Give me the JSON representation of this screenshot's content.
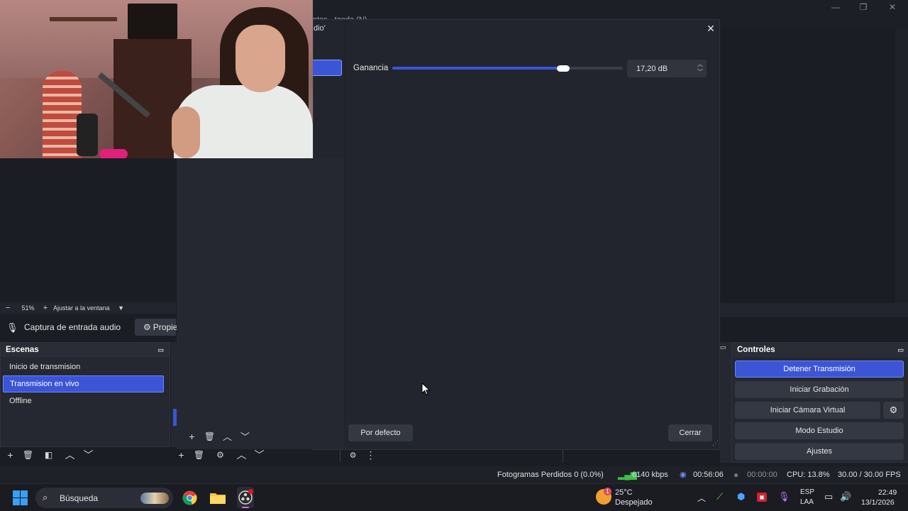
{
  "window": {
    "title_fragment": "dio'",
    "bg_title": "ntos - tanda (N)"
  },
  "dialog": {
    "gain_label": "Ganancia",
    "gain_value": "17,20 dB",
    "gain_level_pct": 74,
    "default_button": "Por defecto",
    "close_button": "Cerrar"
  },
  "preview": {
    "zoom": "51%",
    "fit_label": "Ajustar a la ventana"
  },
  "source_bar": {
    "source_name": "Captura de entrada audio",
    "props_label": "Propie"
  },
  "scenes": {
    "title": "Escenas",
    "items": [
      "Inicio de transmision",
      "Transmision en vivo",
      "Offline"
    ],
    "selected_index": 1
  },
  "controls": {
    "title": "Controles",
    "stop_stream": "Detener Transmisión",
    "start_record": "Iniciar Grabación",
    "start_vcam": "Iniciar Cámara Virtual",
    "studio_mode": "Modo Estudio",
    "settings": "Ajustes"
  },
  "status": {
    "dropped_frames": "Fotogramas Perdidos 0 (0.0%)",
    "bitrate": "6140 kbps",
    "stream_time": "00:56:06",
    "record_time": "00:00:00",
    "cpu": "CPU: 13.8%",
    "fps": "30.00 / 30.00 FPS"
  },
  "taskbar": {
    "search": "Búsqueda",
    "weather_temp": "25°C",
    "weather_desc": "Despejado",
    "weather_badge": "1",
    "lang1": "ESP",
    "lang2": "LAA",
    "time": "22:49",
    "date": "13/1/2026"
  },
  "colors": {
    "accent": "#3b55d6",
    "panel": "#252830",
    "bg": "#1b1d24"
  }
}
